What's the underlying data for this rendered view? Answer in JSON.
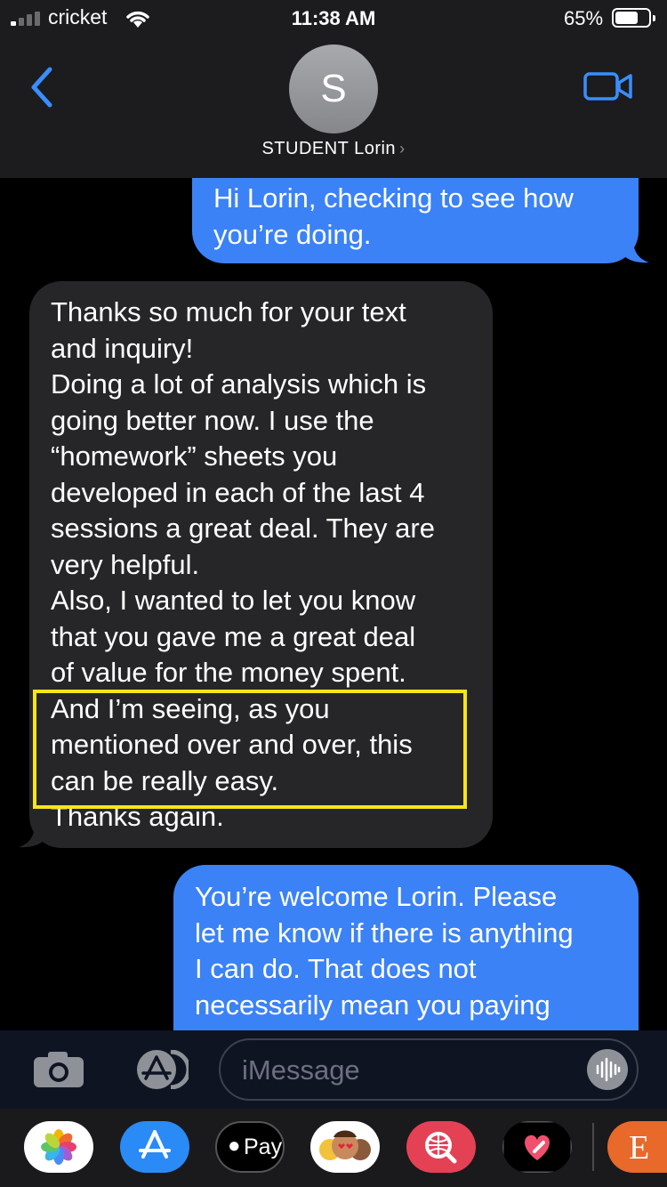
{
  "status_bar": {
    "carrier": "cricket",
    "time": "11:38 AM",
    "battery_percent": "65%",
    "battery_level": 0.65
  },
  "header": {
    "avatar_initial": "S",
    "contact_name": "STUDENT Lorin",
    "contact_chevron": "›",
    "back_icon": "chevron-left-icon",
    "video_icon": "video-camera-icon"
  },
  "messages": [
    {
      "direction": "sent",
      "lines": [
        "Hi Lorin, checking to see how",
        "you’re doing."
      ]
    },
    {
      "direction": "received",
      "lines": [
        "Thanks so much for your text",
        "and inquiry!",
        "Doing a lot of analysis which is",
        "going better now. I use the",
        "“homework” sheets you",
        "developed in each of the last 4",
        "sessions a great deal. They are",
        "very helpful.",
        "Also, I wanted to let you know",
        "that you gave me a great deal",
        "of value for the money spent.",
        "And I’m seeing, as you",
        "mentioned over and over, this",
        "can be really easy.",
        "Thanks again."
      ]
    },
    {
      "direction": "sent",
      "lines": [
        "You’re welcome Lorin. Please",
        "let me know if there is anything",
        "I can do. That does not",
        "necessarily mean you paying"
      ]
    }
  ],
  "highlight_color": "#f7e51b",
  "composer": {
    "placeholder": "iMessage",
    "camera_icon": "camera-icon",
    "apps_icon": "app-store-icon",
    "audio_icon": "audio-waveform-icon"
  },
  "app_drawer": [
    {
      "name": "photos-icon"
    },
    {
      "name": "app-store-icon"
    },
    {
      "name": "apple-pay-icon",
      "label": "Pay"
    },
    {
      "name": "memoji-icon"
    },
    {
      "name": "web-search-icon"
    },
    {
      "name": "digital-touch-icon"
    },
    {
      "name": "etsy-icon",
      "label": "E"
    }
  ],
  "colors": {
    "sent_bubble": "#3b82f6",
    "received_bubble": "#262629",
    "ios_blue": "#3a8eff"
  }
}
